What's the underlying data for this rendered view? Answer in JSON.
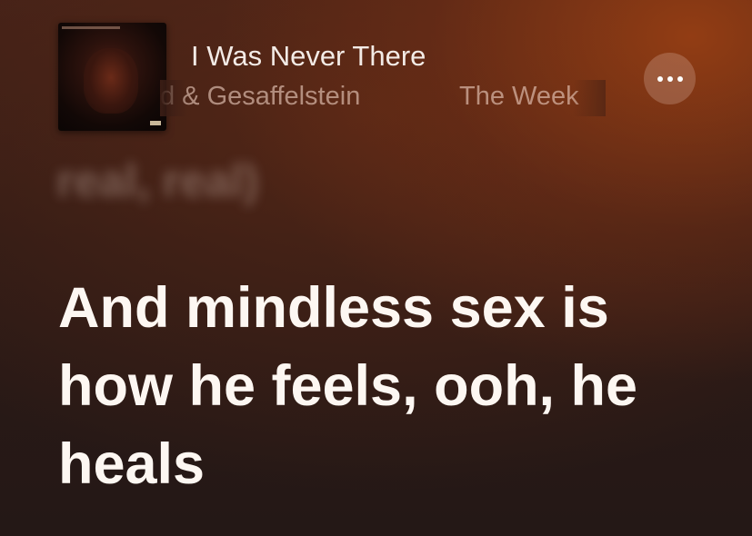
{
  "now_playing": {
    "title": "I Was Never There",
    "artist_primary": "The Weeknd & Gesaffelstein",
    "artist_primary_visible": "d & Gesaffelstein",
    "artist_marquee_visible": "The Week"
  },
  "controls": {
    "more_icon": "more-options-icon"
  },
  "lyrics": {
    "previous_line": "real, real)",
    "current_lines": [
      "And mindless sex is",
      "how he feels, ooh, he",
      "heals"
    ]
  },
  "colors": {
    "background_dark": "#2c1a16",
    "background_accent": "#963e14",
    "lyric_active": "#fdf7f2",
    "artist_text": "#ebcdbe"
  }
}
